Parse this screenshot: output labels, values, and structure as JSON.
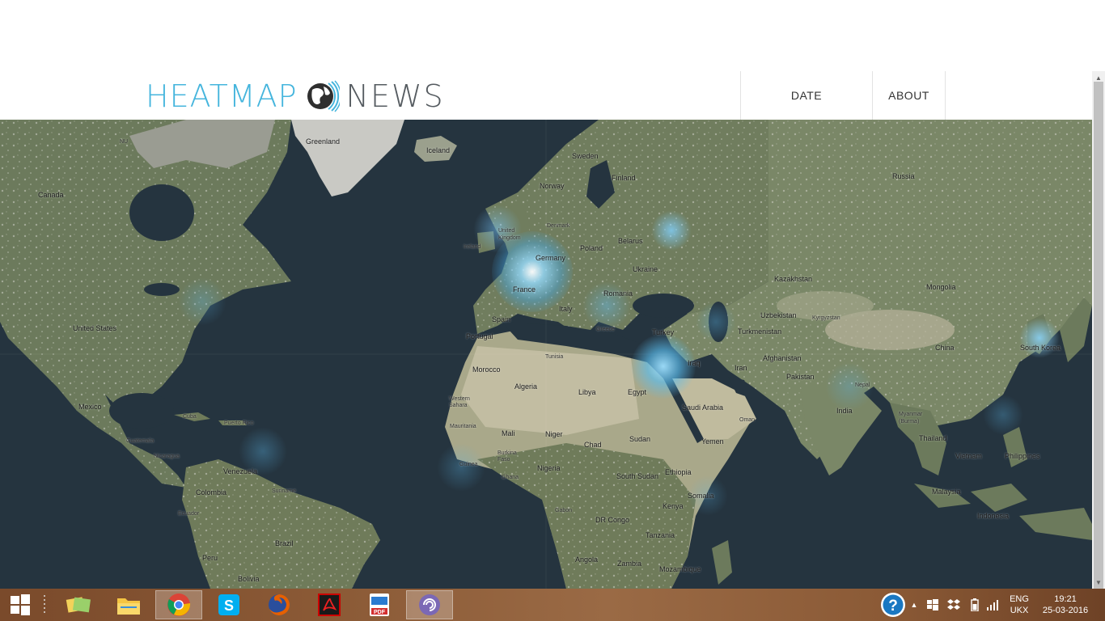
{
  "header": {
    "logo_heatmap": "HEATMAP",
    "logo_news": "NEWS",
    "nav": [
      {
        "label": "DATE"
      },
      {
        "label": "ABOUT"
      }
    ],
    "logo_color": "#45b5dd",
    "news_color": "#555b60"
  },
  "map": {
    "labels": {
      "greenland": "Greenland",
      "iceland": "Iceland",
      "canada": "Canada",
      "nu": "NU",
      "united_states": "United States",
      "mexico": "Mexico",
      "cuba": "Cuba",
      "puerto_rico": "Puerto Rico",
      "guatemala": "Guatemala",
      "nicaragua": "Nicaragua",
      "venezuela": "Venezuela",
      "colombia": "Colombia",
      "suriname": "Suriname",
      "ecuador": "Ecuador",
      "peru": "Peru",
      "brazil": "Brazil",
      "bolivia": "Bolivia",
      "sweden": "Sweden",
      "norway": "Norway",
      "finland": "Finland",
      "united_kingdom": "United Kingdom",
      "ireland": "Ireland",
      "denmark": "Denmark",
      "germany": "Germany",
      "france": "France",
      "poland": "Poland",
      "belarus": "Belarus",
      "ukraine": "Ukraine",
      "romania": "Romania",
      "italy": "Italy",
      "spain": "Spain",
      "portugal": "Portugal",
      "greece": "Greece",
      "turkey": "Turkey",
      "tunisia": "Tunisia",
      "morocco": "Morocco",
      "algeria": "Algeria",
      "libya": "Libya",
      "egypt": "Egypt",
      "western_sahara": "Western Sahara",
      "mauritania": "Mauritania",
      "mali": "Mali",
      "niger": "Niger",
      "chad": "Chad",
      "sudan": "Sudan",
      "burkina_faso": "Burkina Faso",
      "guinea": "Guinea",
      "ghana": "Ghana",
      "nigeria": "Nigeria",
      "south_sudan": "South Sudan",
      "ethiopia": "Ethiopia",
      "somalia": "Somalia",
      "kenya": "Kenya",
      "gabon": "Gabon",
      "dr_congo": "DR Congo",
      "tanzania": "Tanzania",
      "angola": "Angola",
      "zambia": "Zambia",
      "mozambique": "Mozambique",
      "iraq": "Iraq",
      "iran": "Iran",
      "saudi_arabia": "Saudi Arabia",
      "yemen": "Yemen",
      "oman": "Oman",
      "afghanistan": "Afghanistan",
      "pakistan": "Pakistan",
      "india": "India",
      "nepal": "Nepal",
      "russia": "Russia",
      "kazakhstan": "Kazakhstan",
      "uzbekistan": "Uzbekistan",
      "turkmenistan": "Turkmenistan",
      "kyrgyzstan": "Kyrgyzstan",
      "mongolia": "Mongolia",
      "china": "China",
      "south_korea": "South Korea",
      "myanmar": "Myanmar (Burma)",
      "thailand": "Thailand",
      "vietnam": "Vietnam",
      "philippines": "Philippines",
      "malaysia": "Malaysia",
      "indonesia": "Indonesia"
    }
  },
  "taskbar": {
    "apps": [
      "start-icon",
      "task-view-icon",
      "photos-icon",
      "file-explorer-icon",
      "chrome-icon",
      "skype-icon",
      "firefox-icon",
      "acrobat-icon",
      "pdf-icon",
      "torrent-icon"
    ],
    "tray": {
      "lang_top": "ENG",
      "lang_bottom": "UKX",
      "time": "19:21",
      "date": "25-03-2016"
    }
  }
}
